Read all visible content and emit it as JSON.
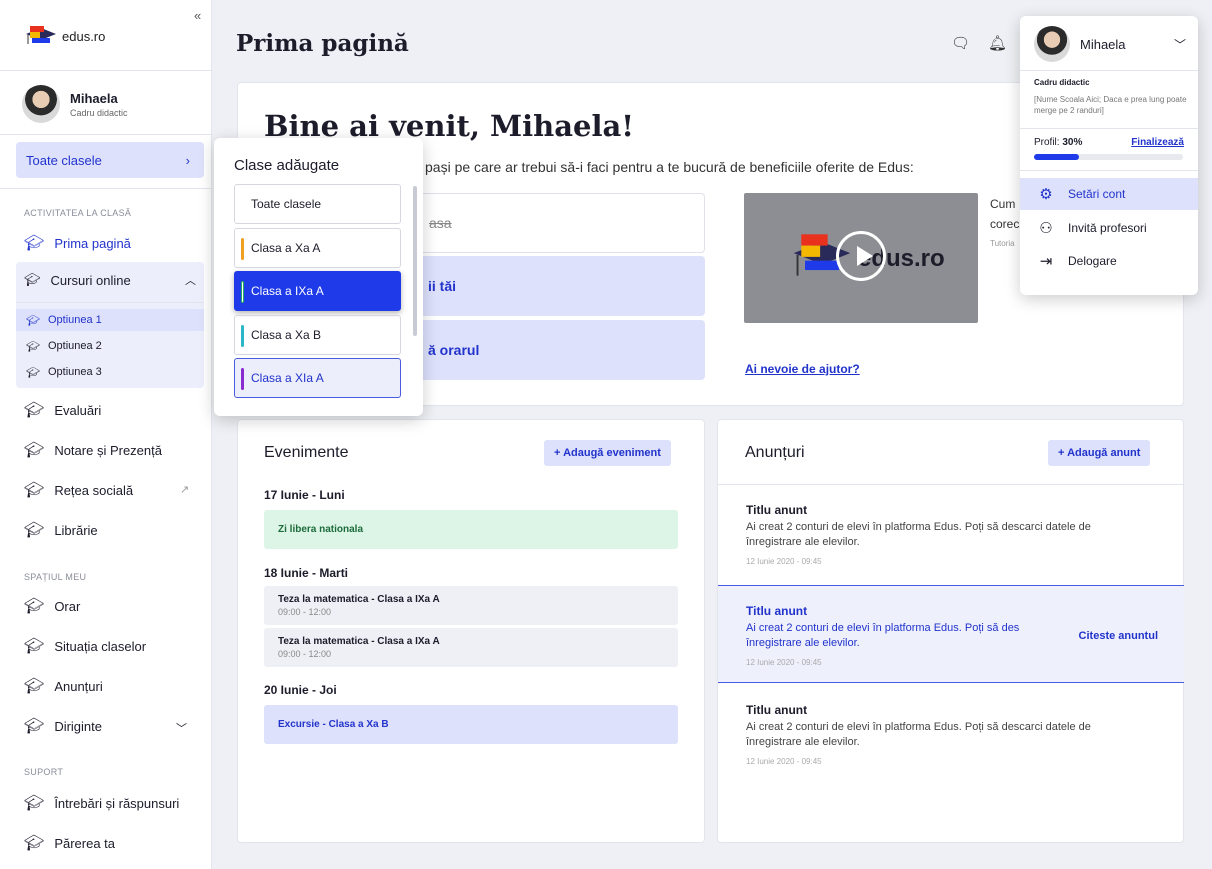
{
  "app": {
    "logo_text": "edus.ro",
    "collapse": "«"
  },
  "user": {
    "name": "Mihaela",
    "role": "Cadru didactic"
  },
  "sidebar": {
    "all_classes": "Toate clasele",
    "section_activity": "ACTIVITATEA LA CLASĂ",
    "section_my_space": "SPAȚIUL MEU",
    "section_support": "SUPORT",
    "items": {
      "home": "Prima pagină",
      "courses": "Cursuri online",
      "option1": "Optiunea 1",
      "option2": "Optiunea 2",
      "option3": "Optiunea 3",
      "evaluations": "Evaluări",
      "grading": "Notare și Prezență",
      "social": "Rețea socială",
      "library": "Librărie",
      "schedule": "Orar",
      "class_status": "Situația claselor",
      "announcements": "Anunțuri",
      "head_teacher": "Diriginte",
      "faq": "Întrebări și răspunsuri",
      "feedback": "Părerea ta"
    }
  },
  "header": {
    "title": "Prima pagină"
  },
  "welcome": {
    "title": "Bine ai venit, Mihaela!",
    "subtitle": "i pași pe care ar trebui să-i faci pentru a te bucură de beneficiile oferite de Edus:",
    "task1": "asa",
    "task2": "ii tăi",
    "task3": "ă orarul",
    "video_logo": "edus.ro",
    "video_caption_1": "Cum",
    "video_caption_2": "corec",
    "video_caption_3": "Tutoria",
    "help": "Ai nevoie de ajutor?"
  },
  "events": {
    "title": "Evenimente",
    "add": "+ Adaugă eveniment",
    "days": [
      {
        "label": "17 Iunie - Luni"
      },
      {
        "label": "18 Iunie - Marti"
      },
      {
        "label": "20 Iunie - Joi"
      }
    ],
    "items": [
      {
        "title": "Zi libera nationala",
        "time": ""
      },
      {
        "title": "Teza la matematica - Clasa a IXa A",
        "time": "09:00 - 12:00"
      },
      {
        "title": "Teza la matematica - Clasa a IXa A",
        "time": "09:00 - 12:00"
      },
      {
        "title": "Excursie - Clasa a Xa B",
        "time": ""
      }
    ]
  },
  "announcements": {
    "title": "Anunțuri",
    "add": "+ Adaugă anunt",
    "read": "Citeste anuntul",
    "items": [
      {
        "title": "Titlu anunt",
        "body": "Ai creat 2 conturi de elevi în platforma Edus. Poți să descarci datele de înregistrare ale elevilor.",
        "date": "12 Iunie 2020 - 09:45"
      },
      {
        "title": "Titlu anunt",
        "body": "Ai creat 2 conturi de elevi în platforma Edus. Poți să des înregistrare ale elevilor.",
        "date": "12 Iunie 2020 - 09:45"
      },
      {
        "title": "Titlu anunt",
        "body": "Ai creat 2 conturi de elevi în platforma Edus. Poți să descarci datele de înregistrare ale elevilor.",
        "date": "12 Iunie 2020 - 09:45"
      }
    ]
  },
  "classes_dropdown": {
    "title": "Clase adăugate",
    "items": [
      {
        "label": "Toate clasele",
        "color": ""
      },
      {
        "label": "Clasa a Xa A",
        "color": "#f0a020"
      },
      {
        "label": "Clasa a IXa A",
        "color": "#ffffff"
      },
      {
        "label": "Clasa a Xa B",
        "color": "#2bb5c8"
      },
      {
        "label": "Clasa a XIa A",
        "color": "#8a2bd0"
      }
    ]
  },
  "account_menu": {
    "name": "Mihaela",
    "role": "Cadru didactic",
    "school": "[Nume Scoala Aici; Daca e prea lung poate merge pe 2 randuri]",
    "profile_label": "Profil:",
    "profile_value": "30%",
    "profile_progress": 0.3,
    "finish": "Finalizează",
    "settings": "Setări cont",
    "invite": "Invită profesori",
    "logout": "Delogare"
  },
  "colors": {
    "primary": "#1f3ae8",
    "accent_light": "#dde1fb",
    "text_link": "#2233cc"
  }
}
